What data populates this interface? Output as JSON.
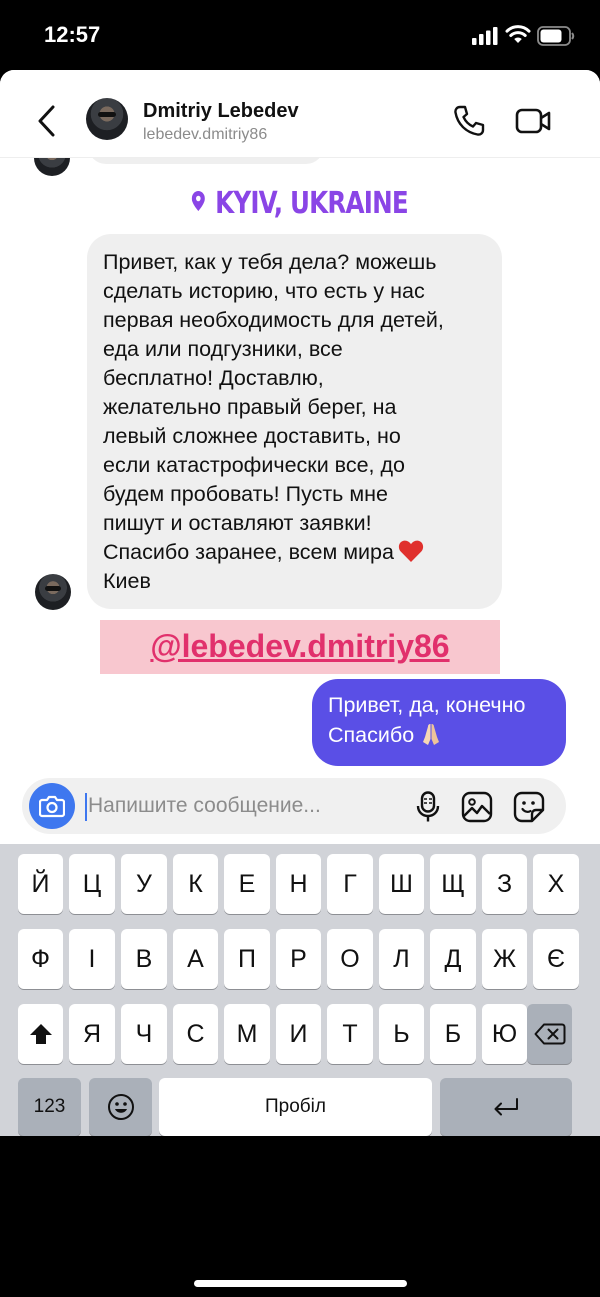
{
  "status_bar": {
    "time": "12:57"
  },
  "header": {
    "contact_name": "Dmitriy Lebedev",
    "contact_handle": "lebedev.dmitriy86"
  },
  "chat": {
    "location_sticker": "KYIV, UKRAINE",
    "incoming_message": "Привет,  как у тебя дела? можешь\nсделать историю, что есть у нас\nпервая необходимость для детей,\nеда или подгузники, все\nбесплатно! Доставлю,\nжелательно правый берег, на\nлевый сложнее доставить, но\nесли катастрофически все, до\nбудем пробовать! Пусть мне\nпишут и оставляют заявки!\nСпасибо заранее, всем мира",
    "incoming_message_tail": "Киев",
    "mention": "@lebedev.dmitriy86",
    "outgoing_message": "Привет, да, конечно\nСпасибо"
  },
  "composer": {
    "placeholder": "Напишите сообщение..."
  },
  "keyboard": {
    "row1": [
      "Й",
      "Ц",
      "У",
      "К",
      "Е",
      "Н",
      "Г",
      "Ш",
      "Щ",
      "З",
      "Х"
    ],
    "row2": [
      "Ф",
      "І",
      "В",
      "А",
      "П",
      "Р",
      "О",
      "Л",
      "Д",
      "Ж",
      "Є"
    ],
    "row3": [
      "Я",
      "Ч",
      "С",
      "М",
      "И",
      "Т",
      "Ь",
      "Б",
      "Ю"
    ],
    "numbers_key": "123",
    "space_key": "Пробіл"
  },
  "colors": {
    "accent_blue": "#3e77ef",
    "outgoing_bubble": "#5a4fe6",
    "location_purple": "#8a45e6",
    "mention_pink": "#e1306c",
    "mention_bg": "#f8c7cf"
  }
}
